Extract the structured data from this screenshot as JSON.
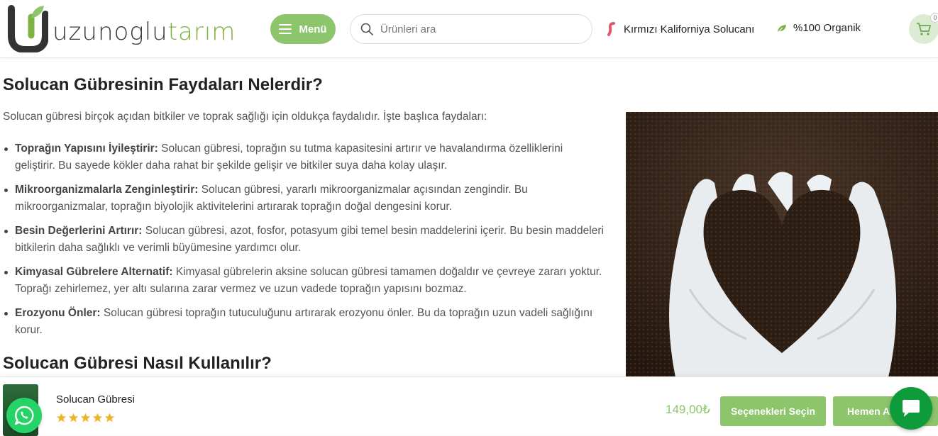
{
  "header": {
    "logo_prefix": "uzunoglu",
    "logo_suffix": "tarım",
    "menu_label": "Menü",
    "search_placeholder": "Ürünleri ara",
    "worm_link": "Kırmızı Kaliforniya Solucanı",
    "organic_label": "%100 Organik",
    "cart_count": "0",
    "icons": {
      "menu": "hamburger-icon",
      "search": "search-icon",
      "worm": "worm-icon",
      "organic": "leaf-icon",
      "cart": "cart-icon"
    },
    "colors": {
      "brand_green": "#8cc56b",
      "cart_bg": "#dcebd1"
    }
  },
  "article": {
    "benefits_heading": "Solucan Gübresinin Faydaları Nelerdir?",
    "intro": "Solucan gübresi birçok açıdan bitkiler ve toprak sağlığı için oldukça faydalıdır. İşte başlıca faydaları:",
    "benefits": [
      {
        "title": "Toprağın Yapısını İyileştirir:",
        "text": " Solucan gübresi, toprağın su tutma kapasitesini artırır ve havalandırma özelliklerini geliştirir. Bu sayede kökler daha rahat bir şekilde gelişir ve bitkiler suya daha kolay ulaşır."
      },
      {
        "title": "Mikroorganizmalarla Zenginleştirir:",
        "text": " Solucan gübresi, yararlı mikroorganizmalar açısından zengindir. Bu mikroorganizmalar, toprağın biyolojik aktivitelerini artırarak toprağın doğal dengesini korur."
      },
      {
        "title": "Besin Değerlerini Artırır:",
        "text": " Solucan gübresi, azot, fosfor, potasyum gibi temel besin maddelerini içerir. Bu besin maddeleri bitkilerin daha sağlıklı ve verimli büyümesine yardımcı olur."
      },
      {
        "title": "Kimyasal Gübrelere Alternatif:",
        "text": " Kimyasal gübrelerin aksine solucan gübresi tamamen doğaldır ve çevreye zararı yoktur. Toprağı zehirlemez, yer altı sularına zarar vermez ve uzun vadede toprağın yapısını bozmaz."
      },
      {
        "title": "Erozyonu Önler:",
        "text": " Solucan gübresi toprağın tutuculuğunu artırarak erozyonu önler. Bu da toprağın uzun vadeli sağlığını korur."
      }
    ],
    "usage_heading": "Solucan Gübresi Nasıl Kullanılır?"
  },
  "sticky_bar": {
    "product_name": "Solucan Gübresi",
    "rating": 5,
    "price": "149,00₺",
    "options_button": "Seçenekleri Seçin",
    "buy_button": "Hemen Al"
  },
  "floating": {
    "whatsapp_icon": "whatsapp-icon",
    "chat_icon": "chat-icon",
    "whatsapp_color": "#25d366",
    "chat_color": "#0d9b3c"
  }
}
